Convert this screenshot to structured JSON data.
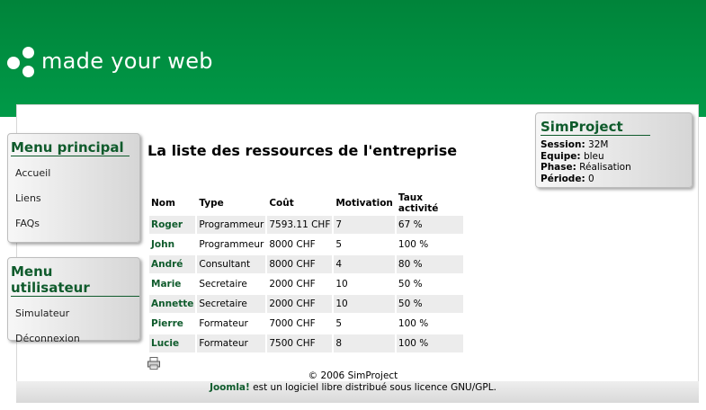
{
  "header": {
    "site_title": "made your web"
  },
  "main_menu": {
    "title": "Menu principal",
    "items": [
      {
        "label": "Accueil"
      },
      {
        "label": "Liens"
      },
      {
        "label": "FAQs"
      }
    ]
  },
  "user_menu": {
    "title": "Menu utilisateur",
    "items": [
      {
        "label": "Simulateur"
      },
      {
        "label": "Déconnexion"
      }
    ]
  },
  "simproject": {
    "title": "SimProject",
    "session_label": "Session:",
    "session_value": "32M",
    "equipe_label": "Equipe:",
    "equipe_value": "bleu",
    "phase_label": "Phase:",
    "phase_value": "Réalisation",
    "periode_label": "Période:",
    "periode_value": "0"
  },
  "page": {
    "heading": "La liste des ressources de l'entreprise"
  },
  "table": {
    "headers": [
      "Nom",
      "Type",
      "Coût",
      "Motivation",
      "Taux activité"
    ],
    "rows": [
      [
        "Roger",
        "Programmeur",
        "7593.11 CHF",
        "7",
        "67 %"
      ],
      [
        "John",
        "Programmeur",
        "8000 CHF",
        "5",
        "100 %"
      ],
      [
        "André",
        "Consultant",
        "8000 CHF",
        "4",
        "80 %"
      ],
      [
        "Marie",
        "Secretaire",
        "2000 CHF",
        "10",
        "50 %"
      ],
      [
        "Annette",
        "Secretaire",
        "2000 CHF",
        "10",
        "50 %"
      ],
      [
        "Pierre",
        "Formateur",
        "7000 CHF",
        "5",
        "100 %"
      ],
      [
        "Lucie",
        "Formateur",
        "7500 CHF",
        "8",
        "100 %"
      ]
    ]
  },
  "footer": {
    "copyright": "© 2006 SimProject",
    "joomla": "Joomla!",
    "license_rest": " est un logiciel libre distribué sous licence GNU/GPL."
  },
  "icons": {
    "print": "print-icon",
    "logo": "logo-dots-icon"
  },
  "colors": {
    "header_green": "#009a48",
    "accent_green": "#0f5b2c"
  }
}
